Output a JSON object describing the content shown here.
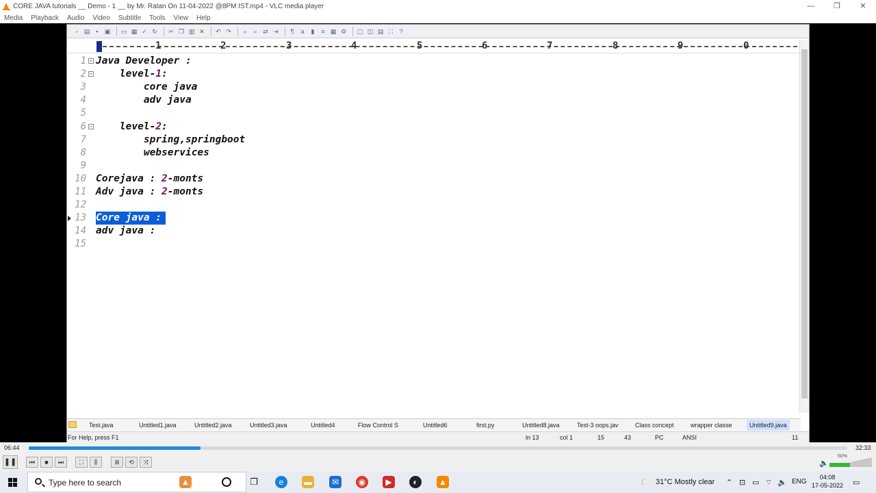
{
  "window": {
    "title": "CORE JAVA tutorials __ Demo - 1 __ by Mr. Ratan On 11-04-2022 @8PM IST.mp4 - VLC media player",
    "controls": [
      "—",
      "❐",
      "✕"
    ]
  },
  "menu": [
    "Media",
    "Playback",
    "Audio",
    "Video",
    "Subtitle",
    "Tools",
    "View",
    "Help"
  ],
  "ruler": {
    "numbers": [
      "1",
      "2",
      "3",
      "4",
      "5",
      "6",
      "7",
      "8",
      "9",
      "0"
    ]
  },
  "editor": {
    "lines": [
      {
        "n": "1",
        "fold": true,
        "text": "Java Developer :"
      },
      {
        "n": "2",
        "fold": true,
        "indent": "    ",
        "pre": "level-",
        "num": "1",
        "post": ":"
      },
      {
        "n": "3",
        "text": "        core java"
      },
      {
        "n": "4",
        "text": "        adv java"
      },
      {
        "n": "5",
        "text": ""
      },
      {
        "n": "6",
        "fold": true,
        "indent": "    ",
        "pre": "level-",
        "num": "2",
        "post": ":"
      },
      {
        "n": "7",
        "text": "        spring,springboot"
      },
      {
        "n": "8",
        "text": "        webservices"
      },
      {
        "n": "9",
        "text": ""
      },
      {
        "n": "10",
        "pre": "Corejava : ",
        "num": "2",
        "post": "-monts"
      },
      {
        "n": "11",
        "pre": "Adv java : ",
        "num": "2",
        "post": "-monts"
      },
      {
        "n": "12",
        "text": ""
      },
      {
        "n": "13",
        "selected": true,
        "text": "Core java :"
      },
      {
        "n": "14",
        "text": "adv java :"
      },
      {
        "n": "15",
        "text": ""
      }
    ],
    "tabs": [
      "Test.java",
      "Untitled1.java",
      "Untitled2.java",
      "Untitled3.java",
      "Untitled4",
      "Flow Control S",
      "Untitled6",
      "first.py",
      "Untitled8.java",
      "Test-3 oops.jav",
      "Class concept",
      "wrapper classe",
      "Untitled9.java"
    ],
    "active_tab": "Untitled9.java",
    "status": {
      "help": "For Help, press F1",
      "ln": "ln 13",
      "col": "col 1",
      "a": "15",
      "b": "43",
      "pc": "PC",
      "enc": "ANSI",
      "last": "11"
    }
  },
  "player": {
    "elapsed": "06:44",
    "total": "32:33",
    "progress": 0.21,
    "volume_label": "60%",
    "volume": 0.6
  },
  "taskbar": {
    "search_placeholder": "Type here to search",
    "weather": "31°C  Mostly clear",
    "lang": "ENG",
    "time": "04:08",
    "date": "17-05-2022"
  },
  "colors": {
    "accent": "#1a8be0",
    "selection": "#0a5fd8",
    "number": "#7a0a6e"
  }
}
